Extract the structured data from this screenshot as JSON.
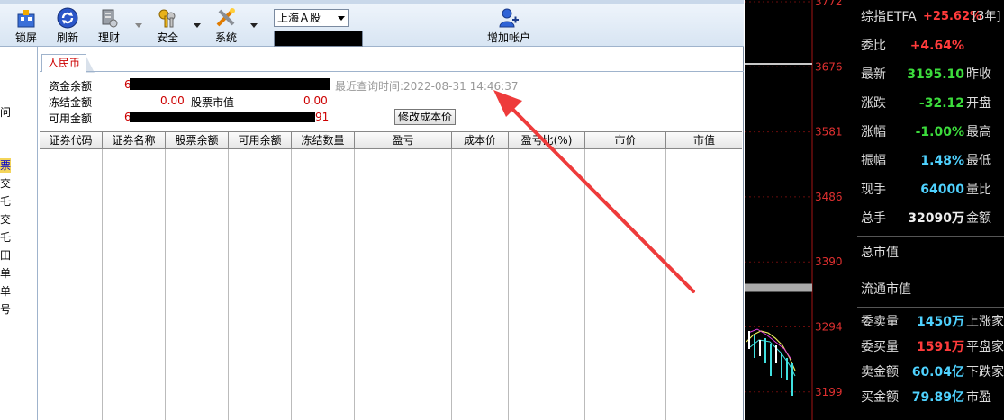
{
  "toolbar": {
    "lock": "锁屏",
    "refresh": "刷新",
    "finance": "理财",
    "security": "安全",
    "system": "系统",
    "add_account": "增加帐户",
    "market_selected": "上海Ａ股"
  },
  "left_nav": {
    "chars": [
      "问",
      "票",
      "交",
      "乇",
      "交",
      "乇",
      "田",
      "单",
      "单",
      "号"
    ],
    "selected_index": 1
  },
  "tab": {
    "label": "人民币"
  },
  "funds": {
    "balance_label": "资金余额",
    "frozen_label": "冻结金额",
    "frozen_value": "0.00",
    "stock_value_label": "股票市值",
    "stock_value": "0.00",
    "available_label": "可用金额",
    "balance_prefix": "6",
    "available_prefix": "6",
    "available_suffix": "91",
    "query_time": "最近查询时间:2022-08-31 14:46:37",
    "modify_cost_button": "修改成本价"
  },
  "table": {
    "columns": [
      "证券代码",
      "证券名称",
      "股票余额",
      "可用余额",
      "冻结数量",
      "盈亏",
      "成本价",
      "盈亏比(%)",
      "市价",
      "市值"
    ],
    "rows": []
  },
  "chart_axis": {
    "labels": [
      "3772",
      "3676",
      "3581",
      "3486",
      "3390",
      "3294",
      "3199"
    ]
  },
  "quote": {
    "title_name": "综指ETFA",
    "title_change": "+25.62%",
    "title_extra": "[3年]",
    "rows": [
      {
        "key": "委比",
        "value": "+4.64%",
        "color": "#ff3b3b",
        "key2": ""
      },
      {
        "key": "最新",
        "value": "3195.10",
        "color": "#3cdc3c",
        "key2": "昨收"
      },
      {
        "key": "涨跌",
        "value": "-32.12",
        "color": "#3cdc3c",
        "key2": "开盘"
      },
      {
        "key": "涨幅",
        "value": "-1.00%",
        "color": "#3cdc3c",
        "key2": "最高"
      },
      {
        "key": "振幅",
        "value": "1.48%",
        "color": "#4fd2ff",
        "key2": "最低"
      },
      {
        "key": "现手",
        "value": "64000",
        "color": "#4fd2ff",
        "key2": "量比"
      },
      {
        "key": "总手",
        "value": "32090万",
        "color": "#eeeeee",
        "key2": "金额"
      }
    ],
    "total_market_value": "总市值",
    "circulating_market_value": "流通市值",
    "rows2": [
      {
        "key": "委卖量",
        "value": "1450万",
        "color": "#4fd2ff",
        "key2": "上涨家"
      },
      {
        "key": "委买量",
        "value": "1591万",
        "color": "#ff3b3b",
        "key2": "平盘家"
      },
      {
        "key": "卖金额",
        "value": "60.04亿",
        "color": "#4fd2ff",
        "key2": "下跌家"
      },
      {
        "key": "买金额",
        "value": "79.89亿",
        "color": "#4fd2ff",
        "key2": "市盈"
      }
    ]
  }
}
